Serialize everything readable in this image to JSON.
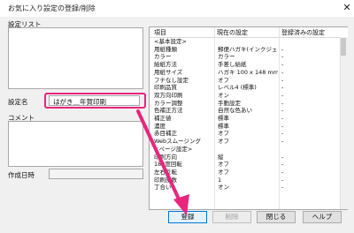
{
  "window": {
    "title": "お気に入り設定の登録/削除",
    "close_glyph": "✕"
  },
  "left": {
    "settings_list_label": "設定リスト",
    "settings_name_label": "設定名",
    "settings_name_value": "はがき＿年賀印刷",
    "comment_label": "コメント",
    "created_label": "作成日時"
  },
  "table": {
    "headers": [
      "項目",
      "現在の設定",
      "登録済みの設定"
    ],
    "rows": [
      [
        "<基本設定>",
        "",
        ""
      ],
      [
        "用紙種類",
        "郵便ハガキ(インクジェット...",
        "-"
      ],
      [
        "カラー",
        "カラー",
        "-"
      ],
      [
        "給紙方法",
        "手差し給紙",
        "-"
      ],
      [
        "用紙サイズ",
        "ハガキ 100 x 148 mm",
        "-"
      ],
      [
        "フチなし設定",
        "オフ",
        "-"
      ],
      [
        "印刷品質",
        "レベル4 (標準)",
        "-"
      ],
      [
        "双方向印刷",
        "オン",
        "-"
      ],
      [
        "カラー調整",
        "手動設定",
        "-"
      ],
      [
        "色補正方法",
        "自然な色あい",
        "-"
      ],
      [
        "補正値",
        "標準",
        "-"
      ],
      [
        "濃度",
        "標準",
        "-"
      ],
      [
        "赤目補正",
        "オフ",
        "-"
      ],
      [
        "Webスムージング",
        "オフ",
        "-"
      ],
      [
        "<ページ設定>",
        "",
        ""
      ],
      [
        "印刷方向",
        "縦",
        "-"
      ],
      [
        "180度回転",
        "オフ",
        "-"
      ],
      [
        "左右反転",
        "オフ",
        "-"
      ],
      [
        "印刷部数",
        "1",
        "-"
      ],
      [
        "丁合い",
        "オン",
        "-"
      ]
    ]
  },
  "buttons": {
    "register": "登録",
    "delete": "削除",
    "close": "閉じる",
    "help": "ヘルプ"
  },
  "colors": {
    "highlight": "#e8267d",
    "arrow": "#e8267d"
  }
}
